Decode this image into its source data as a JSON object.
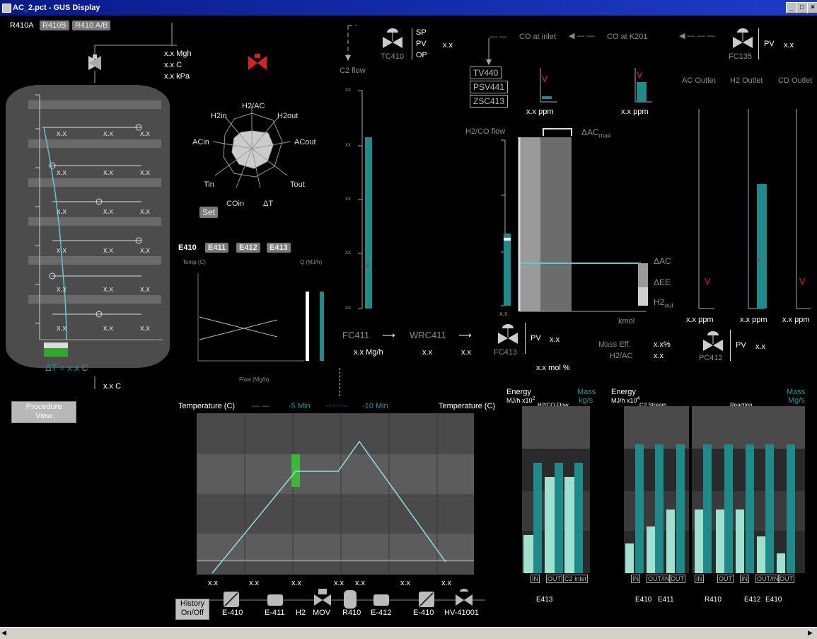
{
  "window": {
    "title": "AC_2.pct - GUS Display"
  },
  "unit_tabs": [
    "R410A",
    "R410B",
    "R410 A/B"
  ],
  "reactor": {
    "header_values": [
      "x.x Mgh",
      "x.x C",
      "x.x kPa"
    ],
    "delta_t": "ΔT =  x.x C",
    "bottom_value": "x.x C",
    "tick_xx": "xx",
    "row_values": "x.x"
  },
  "procedure_btn": "Procedure\nView",
  "radar": {
    "labels": [
      "H2/AC",
      "H2out",
      "ACout",
      "Tout",
      "ΔT",
      "COin",
      "Tin",
      "ACin",
      "H2in"
    ],
    "set_label": "Set"
  },
  "exchangers": {
    "tabs": [
      "E410",
      "E411",
      "E412",
      "E413"
    ],
    "temp_axis": "Temp (C)",
    "q_axis": "Q (MJ/h)",
    "flow_axis": "Flow (Mg/h)"
  },
  "tc410": {
    "tag": "TC410",
    "labels": [
      "SP",
      "PV",
      "OP"
    ],
    "value": "x.x"
  },
  "c2flow": {
    "label": "C2 flow",
    "fc": "FC411",
    "fc_value": "x.x Mg/h",
    "wrc": "WRC411",
    "wrc_value": "x.x",
    "x3": "x.x"
  },
  "co": {
    "at_inlet": "CO at inlet",
    "at_k201": "CO at K201",
    "ppm1": "x.x ppm",
    "ppm2": "x.x ppm",
    "tags": [
      "TV440",
      "PSV441",
      "ZSC413"
    ]
  },
  "fc135": {
    "tag": "FC135",
    "pv": "PV",
    "value": "x.x"
  },
  "h2co": {
    "label": "H2/CO flow",
    "delta_ac_max": "ΔAC",
    "max_sub": "max",
    "delta_ac": "ΔAC",
    "delta_ee": "ΔEE",
    "h2out": "H2",
    "h2out_sub": "out",
    "kmol": "kmol",
    "fc413": "FC413",
    "pv": "PV",
    "pv_value": "x.x",
    "mol": "x.x mol %",
    "mass_eff": "Mass Eff.",
    "mass_eff_val": "x.x%",
    "h2ac": "H2/AC",
    "h2ac_val": "x.x",
    "xx": "x.x"
  },
  "outlets": {
    "labels": [
      "AC Outlet",
      "H2 Outlet",
      "CD Outlet"
    ],
    "ppm": [
      "x.x ppm",
      "x.x ppm",
      "x.x ppm"
    ]
  },
  "pc412": {
    "tag": "PC412",
    "pv": "PV",
    "value": "x.x"
  },
  "temp_profile": {
    "left_title": "Temperature (C)",
    "right_title": "Temperature (C)",
    "legend_5": "-5 Min",
    "legend_10": "-10 Min",
    "x_values": [
      "x.x",
      "x.x",
      "x.x",
      "x.x",
      "x.x",
      "x.x",
      "x.x"
    ],
    "equipment": [
      "E-410",
      "E-411",
      "H2",
      "MOV",
      "R410",
      "E-412",
      "E-410",
      "HV-41001"
    ],
    "history_btn": "History\nOn/Off"
  },
  "energy1": {
    "title": "Energy",
    "units": "MJ/h x10",
    "exp": "2",
    "mass": "Mass",
    "mass_u": "kg/s",
    "section": "H2/CO Flow",
    "buttons": [
      "IN",
      "OUT",
      "C2 Inlet"
    ],
    "eq": "E413"
  },
  "energy2": {
    "title": "Energy",
    "units": "MJ/h x10",
    "exp": "4",
    "mass": "Mass",
    "mass_u": "Mg/s",
    "sections": [
      "C2 Stream",
      "Reaction"
    ],
    "buttons": [
      "IN",
      "OUT/IN",
      "OUT",
      "IN",
      "OUT",
      "IN",
      "OUT/IN",
      "OUT"
    ],
    "eqs": [
      "E410",
      "E411",
      "R410",
      "E412",
      "E410"
    ]
  },
  "colors": {
    "teal": "#1e8a8a",
    "red": "#e02020",
    "green": "#2ea82e",
    "panel": "#3a3a3a"
  }
}
